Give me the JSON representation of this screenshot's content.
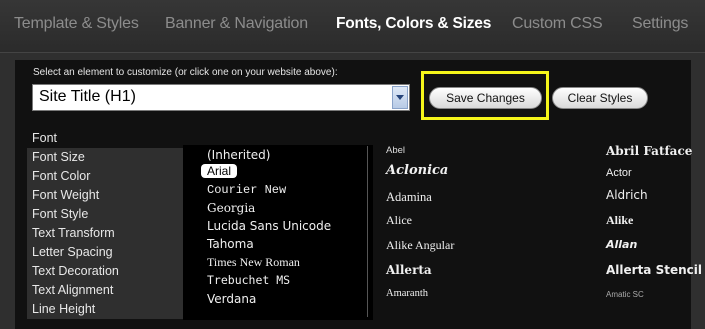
{
  "tabs": [
    {
      "label": "Template & Styles"
    },
    {
      "label": "Banner & Navigation"
    },
    {
      "label": "Fonts, Colors & Sizes"
    },
    {
      "label": "Custom CSS"
    },
    {
      "label": "Settings"
    }
  ],
  "active_tab": "Fonts, Colors & Sizes",
  "element_prompt": "Select an element to customize (or click one on your website above):",
  "element_select": {
    "value": "Site Title (H1)"
  },
  "buttons": {
    "save": "Save Changes",
    "clear": "Clear Styles"
  },
  "properties": [
    {
      "label": "Font"
    },
    {
      "label": "Font Size"
    },
    {
      "label": "Font Color"
    },
    {
      "label": "Font Weight"
    },
    {
      "label": "Font Style"
    },
    {
      "label": "Text Transform"
    },
    {
      "label": "Letter Spacing"
    },
    {
      "label": "Text Decoration"
    },
    {
      "label": "Text Alignment"
    },
    {
      "label": "Line Height"
    }
  ],
  "selected_property": "Font",
  "web_fonts": [
    {
      "label": "(Inherited)"
    },
    {
      "label": "Arial"
    },
    {
      "label": "Courier New"
    },
    {
      "label": "Georgia"
    },
    {
      "label": "Lucida Sans Unicode"
    },
    {
      "label": "Tahoma"
    },
    {
      "label": "Times New Roman"
    },
    {
      "label": "Trebuchet MS"
    },
    {
      "label": "Verdana"
    }
  ],
  "selected_font": "Arial",
  "google_fonts": {
    "col1": [
      {
        "label": "Abel"
      },
      {
        "label": "Aclonica"
      },
      {
        "label": "Adamina"
      },
      {
        "label": "Alice"
      },
      {
        "label": "Alike Angular"
      },
      {
        "label": "Allerta"
      },
      {
        "label": "Amaranth"
      }
    ],
    "col2": [
      {
        "label": "Abril Fatface"
      },
      {
        "label": "Actor"
      },
      {
        "label": "Aldrich"
      },
      {
        "label": "Alike"
      },
      {
        "label": "Allan"
      },
      {
        "label": "Allerta Stencil"
      },
      {
        "label": "Amatic SC"
      }
    ]
  },
  "colors": {
    "highlight": "#f5f51a",
    "panel_bg": "#111111",
    "bar_bg": "#2f2f2f"
  }
}
